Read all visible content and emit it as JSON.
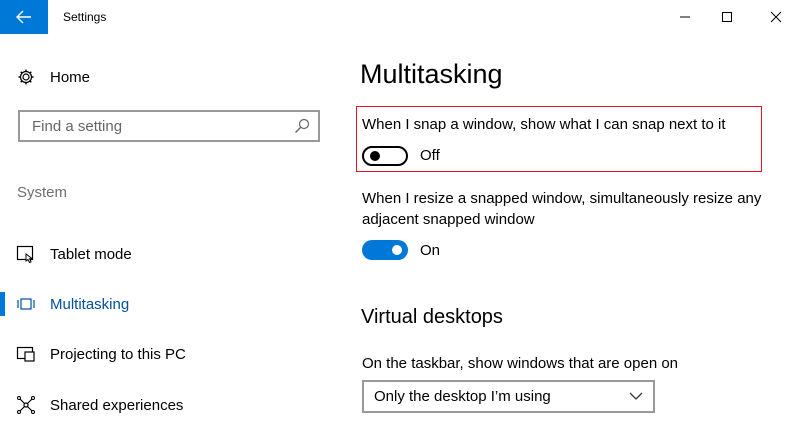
{
  "window": {
    "title": "Settings"
  },
  "sidebar": {
    "home_label": "Home",
    "search_placeholder": "Find a setting",
    "section_label": "System",
    "items": [
      {
        "label": "Tablet mode",
        "icon": "tablet-mode-icon"
      },
      {
        "label": "Multitasking",
        "icon": "multitasking-icon",
        "active": true
      },
      {
        "label": "Projecting to this PC",
        "icon": "projecting-icon"
      },
      {
        "label": "Shared experiences",
        "icon": "shared-experiences-icon"
      }
    ]
  },
  "main": {
    "title": "Multitasking",
    "snap_setting": {
      "text": "When I snap a window, show what I can snap next to it",
      "state_label": "Off"
    },
    "resize_setting": {
      "text": "When I resize a snapped window, simultaneously resize any adjacent snapped window",
      "state_label": "On"
    },
    "virtual_desktops": {
      "title": "Virtual desktops",
      "taskbar_text": "On the taskbar, show windows that are open on",
      "dropdown_value": "Only the desktop I’m using"
    }
  },
  "colors": {
    "accent": "#0078d7",
    "highlight_border": "#e81123"
  }
}
